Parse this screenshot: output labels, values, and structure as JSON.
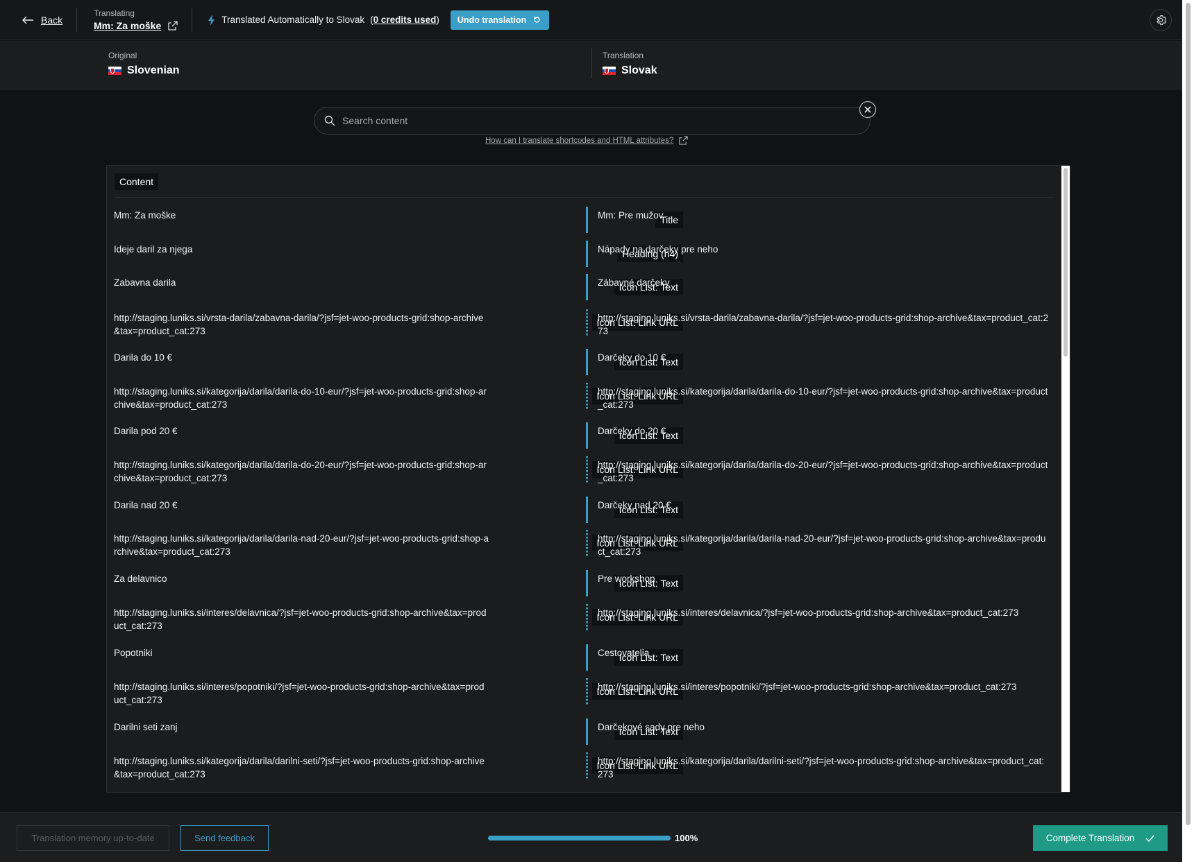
{
  "topbar": {
    "back_label": "Back",
    "translating_label": "Translating",
    "document_title": "Mm: Za moške",
    "auto_text": "Translated Automatically to Slovak",
    "credits_open": "(",
    "credits_text": "0 credits used",
    "credits_close": ")",
    "undo_label": "Undo translation"
  },
  "languages": {
    "original_label": "Original",
    "original_name": "Slovenian",
    "translation_label": "Translation",
    "translation_name": "Slovak"
  },
  "search": {
    "placeholder": "Search content",
    "help_link": "How can I translate shortcodes and HTML attributes?"
  },
  "panel": {
    "tab_label": "Content"
  },
  "rows": [
    {
      "original": "Mm: Za moške",
      "type": "Title",
      "translation": "Mm: Pre mužov"
    },
    {
      "original": "Ideje daril za njega",
      "type": "Heading (h4)",
      "translation": "Nápady na darčeky pre neho"
    },
    {
      "original": "Zabavna darila",
      "type": "Icon List: Text",
      "translation": "Zábavné darčeky"
    },
    {
      "original": "http://staging.luniks.si/vrsta-darila/zabavna-darila/?jsf=jet-woo-products-grid:shop-archive&tax=product_cat:273",
      "type": "Icon List: Link URL",
      "translation": "http://staging.luniks.si/vrsta-darila/zabavna-darila/?jsf=jet-woo-products-grid:shop-archive&tax=product_cat:273"
    },
    {
      "original": "Darila do 10 €",
      "type": "Icon List: Text",
      "translation": "Darčeky do 10 €"
    },
    {
      "original": "http://staging.luniks.si/kategorija/darila/darila-do-10-eur/?jsf=jet-woo-products-grid:shop-archive&tax=product_cat:273",
      "type": "Icon List: Link URL",
      "translation": "http://staging.luniks.si/kategorija/darila/darila-do-10-eur/?jsf=jet-woo-products-grid:shop-archive&tax=product_cat:273"
    },
    {
      "original": "Darila pod 20 €",
      "type": "Icon List: Text",
      "translation": "Darčeky do 20 €"
    },
    {
      "original": "http://staging.luniks.si/kategorija/darila/darila-do-20-eur/?jsf=jet-woo-products-grid:shop-archive&tax=product_cat:273",
      "type": "Icon List: Link URL",
      "translation": "http://staging.luniks.si/kategorija/darila/darila-do-20-eur/?jsf=jet-woo-products-grid:shop-archive&tax=product_cat:273"
    },
    {
      "original": "Darila nad 20 €",
      "type": "Icon List: Text",
      "translation": "Darčeky nad 20 €"
    },
    {
      "original": "http://staging.luniks.si/kategorija/darila/darila-nad-20-eur/?jsf=jet-woo-products-grid:shop-archive&tax=product_cat:273",
      "type": "Icon List: Link URL",
      "translation": "http://staging.luniks.si/kategorija/darila/darila-nad-20-eur/?jsf=jet-woo-products-grid:shop-archive&tax=product_cat:273"
    },
    {
      "original": "Za delavnico",
      "type": "Icon List: Text",
      "translation": "Pre workshop"
    },
    {
      "original": "http://staging.luniks.si/interes/delavnica/?jsf=jet-woo-products-grid:shop-archive&tax=product_cat:273",
      "type": "Icon List: Link URL",
      "translation": "http://staging.luniks.si/interes/delavnica/?jsf=jet-woo-products-grid:shop-archive&tax=product_cat:273"
    },
    {
      "original": "Popotniki",
      "type": "Icon List: Text",
      "translation": "Cestovatelia"
    },
    {
      "original": "http://staging.luniks.si/interes/popotniki/?jsf=jet-woo-products-grid:shop-archive&tax=product_cat:273",
      "type": "Icon List: Link URL",
      "translation": "http://staging.luniks.si/interes/popotniki/?jsf=jet-woo-products-grid:shop-archive&tax=product_cat:273"
    },
    {
      "original": "Darilni seti zanj",
      "type": "Icon List: Text",
      "translation": "Darčekové sady pre neho"
    },
    {
      "original": "http://staging.luniks.si/kategorija/darila/darilni-seti/?jsf=jet-woo-products-grid:shop-archive&tax=product_cat:273",
      "type": "Icon List: Link URL",
      "translation": "http://staging.luniks.si/kategorija/darila/darilni-seti/?jsf=jet-woo-products-grid:shop-archive&tax=product_cat:273"
    }
  ],
  "footer": {
    "memory_label": "Translation memory up-to-date",
    "feedback_label": "Send feedback",
    "progress": 100,
    "progress_text": "100%",
    "complete_label": "Complete Translation"
  },
  "colors": {
    "accent": "#3aa0c6",
    "complete": "#1f9a86",
    "background": "#111213"
  }
}
